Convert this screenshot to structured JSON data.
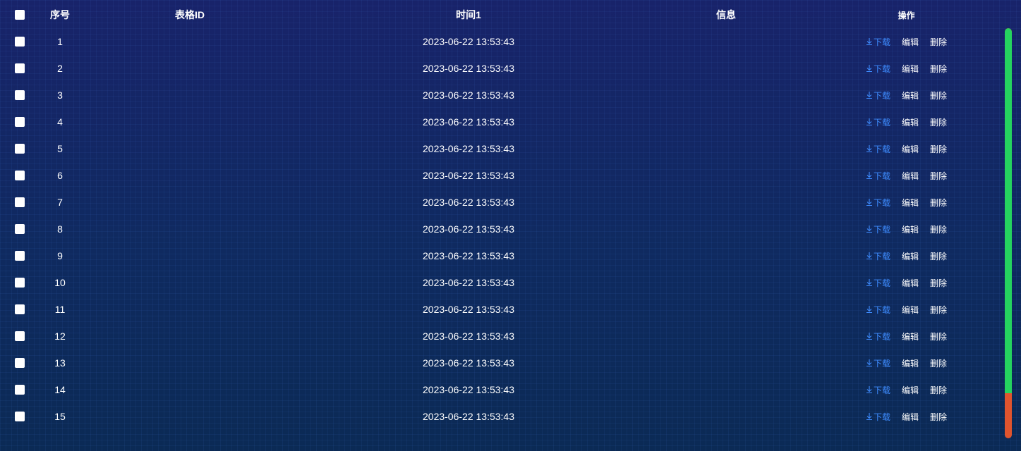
{
  "table": {
    "columns": {
      "index": "序号",
      "id": "表格ID",
      "time": "时间1",
      "info": "信息",
      "ops": "操作"
    },
    "actions": {
      "download": "下载",
      "edit": "编辑",
      "delete": "删除"
    },
    "rows": [
      {
        "index": "1",
        "id": "",
        "time": "2023-06-22 13:53:43",
        "info": ""
      },
      {
        "index": "2",
        "id": "",
        "time": "2023-06-22 13:53:43",
        "info": ""
      },
      {
        "index": "3",
        "id": "",
        "time": "2023-06-22 13:53:43",
        "info": ""
      },
      {
        "index": "4",
        "id": "",
        "time": "2023-06-22 13:53:43",
        "info": ""
      },
      {
        "index": "5",
        "id": "",
        "time": "2023-06-22 13:53:43",
        "info": ""
      },
      {
        "index": "6",
        "id": "",
        "time": "2023-06-22 13:53:43",
        "info": ""
      },
      {
        "index": "7",
        "id": "",
        "time": "2023-06-22 13:53:43",
        "info": ""
      },
      {
        "index": "8",
        "id": "",
        "time": "2023-06-22 13:53:43",
        "info": ""
      },
      {
        "index": "9",
        "id": "",
        "time": "2023-06-22 13:53:43",
        "info": ""
      },
      {
        "index": "10",
        "id": "",
        "time": "2023-06-22 13:53:43",
        "info": ""
      },
      {
        "index": "11",
        "id": "",
        "time": "2023-06-22 13:53:43",
        "info": ""
      },
      {
        "index": "12",
        "id": "",
        "time": "2023-06-22 13:53:43",
        "info": ""
      },
      {
        "index": "13",
        "id": "",
        "time": "2023-06-22 13:53:43",
        "info": ""
      },
      {
        "index": "14",
        "id": "",
        "time": "2023-06-22 13:53:43",
        "info": ""
      },
      {
        "index": "15",
        "id": "",
        "time": "2023-06-22 13:53:43",
        "info": ""
      }
    ]
  },
  "scrollbar": {
    "thumb_fraction": 0.89,
    "thumb_color": "#25d35f",
    "track_color": "#e0542e"
  },
  "colors": {
    "background": "#0c2358",
    "link": "#3e8cff",
    "text": "#ffffff"
  },
  "icons": {
    "download": "download-arrow-icon",
    "checkbox": "checkbox-icon"
  }
}
